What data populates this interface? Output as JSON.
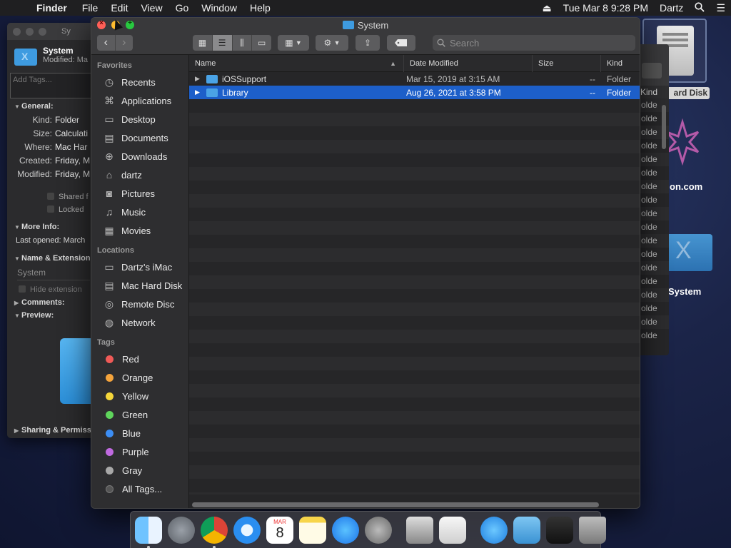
{
  "menubar": {
    "app_name": "Finder",
    "items": [
      "File",
      "Edit",
      "View",
      "Go",
      "Window",
      "Help"
    ],
    "datetime": "Tue Mar 8  9:28 PM",
    "user": "Dartz"
  },
  "info_panel": {
    "title": "Sy",
    "name": "System",
    "modified": "Modified: Ma",
    "tags_placeholder": "Add Tags...",
    "general_label": "General:",
    "rows": [
      {
        "k": "Kind:",
        "v": "Folder"
      },
      {
        "k": "Size:",
        "v": "Calculati"
      },
      {
        "k": "Where:",
        "v": "Mac Har"
      },
      {
        "k": "Created:",
        "v": "Friday, M"
      },
      {
        "k": "Modified:",
        "v": "Friday, M"
      }
    ],
    "shared_label": "Shared f",
    "locked_label": "Locked",
    "more_info_label": "More Info:",
    "last_opened": "Last opened: March",
    "name_ext_label": "Name & Extension",
    "name_value": "System",
    "hide_ext_label": "Hide extension",
    "comments_label": "Comments:",
    "preview_label": "Preview:",
    "sharing_label": "Sharing & Permiss"
  },
  "finder": {
    "title": "System",
    "search_placeholder": "Search",
    "columns": {
      "name": "Name",
      "date": "Date Modified",
      "size": "Size",
      "kind": "Kind"
    },
    "rows": [
      {
        "name": "iOSSupport",
        "date": "Mar 15, 2019 at 3:15 AM",
        "size": "--",
        "kind": "Folder",
        "selected": false
      },
      {
        "name": "Library",
        "date": "Aug 26, 2021 at 3:58 PM",
        "size": "--",
        "kind": "Folder",
        "selected": true
      }
    ],
    "sidebar": {
      "favorites_label": "Favorites",
      "favorites": [
        {
          "label": "Recents",
          "icon": "clock-icon"
        },
        {
          "label": "Applications",
          "icon": "applications-icon"
        },
        {
          "label": "Desktop",
          "icon": "desktop-icon"
        },
        {
          "label": "Documents",
          "icon": "document-icon"
        },
        {
          "label": "Downloads",
          "icon": "download-icon"
        },
        {
          "label": "dartz",
          "icon": "home-icon"
        },
        {
          "label": "Pictures",
          "icon": "camera-icon"
        },
        {
          "label": "Music",
          "icon": "music-note-icon"
        },
        {
          "label": "Movies",
          "icon": "film-icon"
        }
      ],
      "locations_label": "Locations",
      "locations": [
        {
          "label": "Dartz's iMac",
          "icon": "imac-icon"
        },
        {
          "label": "Mac Hard Disk",
          "icon": "hard-disk-icon"
        },
        {
          "label": "Remote Disc",
          "icon": "disc-icon"
        },
        {
          "label": "Network",
          "icon": "network-globe-icon"
        }
      ],
      "tags_label": "Tags",
      "tags": [
        {
          "label": "Red",
          "color": "#f05a57"
        },
        {
          "label": "Orange",
          "color": "#f5a43c"
        },
        {
          "label": "Yellow",
          "color": "#f5d63a"
        },
        {
          "label": "Green",
          "color": "#5fd55c"
        },
        {
          "label": "Blue",
          "color": "#3c8ef5"
        },
        {
          "label": "Purple",
          "color": "#c06ae0"
        },
        {
          "label": "Gray",
          "color": "#a8a8a8"
        }
      ],
      "all_tags": "All Tags..."
    }
  },
  "back_window": {
    "kind_header": "Kind",
    "cells": [
      "olde",
      "olde",
      "olde",
      "olde",
      "olde",
      "olde",
      "olde",
      "olde",
      "olde",
      "olde",
      "olde",
      "olde",
      "olde",
      "olde",
      "olde",
      "olde",
      "olde",
      "olde"
    ]
  },
  "desktop": {
    "disk_label": "ard Disk",
    "com_label": "on.com",
    "system_label": "System"
  },
  "dock": [
    {
      "name": "finder",
      "running": true
    },
    {
      "name": "launchpad",
      "running": false
    },
    {
      "name": "chrome",
      "running": true
    },
    {
      "name": "safari",
      "running": false
    },
    {
      "name": "calendar",
      "running": false,
      "month": "MAR",
      "day": "8"
    },
    {
      "name": "notes",
      "running": false
    },
    {
      "name": "app-store",
      "running": false
    },
    {
      "name": "system-preferences",
      "running": false
    },
    {
      "name": "automator",
      "running": false
    },
    {
      "name": "numbers",
      "running": false
    },
    {
      "name": "applications-folder",
      "running": false
    },
    {
      "name": "downloads-folder",
      "running": false
    },
    {
      "name": "screenshot-stack",
      "running": false
    },
    {
      "name": "trash",
      "running": false
    }
  ]
}
